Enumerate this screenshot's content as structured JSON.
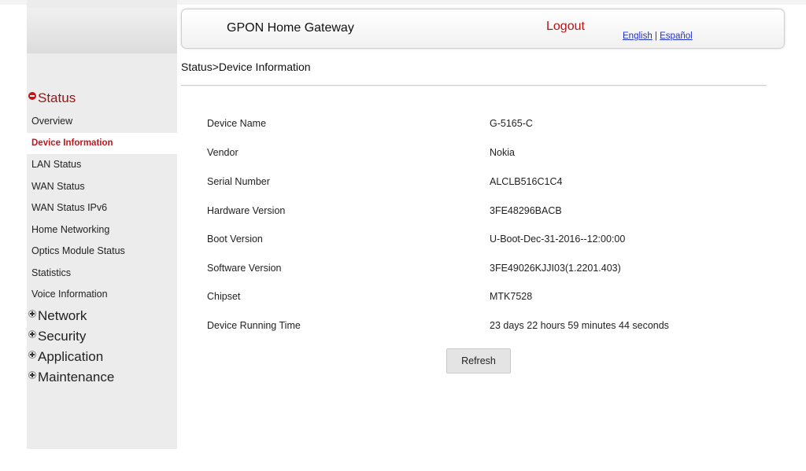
{
  "header": {
    "title": "GPON Home Gateway",
    "logout": "Logout",
    "lang_english": "English",
    "lang_sep": "|",
    "lang_espanol": "Español"
  },
  "breadcrumb": "Status>Device Information",
  "sidebar": {
    "sections": [
      {
        "label": "Status",
        "expanded": true,
        "items": [
          {
            "label": "Overview"
          },
          {
            "label": "Device Information",
            "active": true
          },
          {
            "label": "LAN Status"
          },
          {
            "label": "WAN Status"
          },
          {
            "label": "WAN Status IPv6"
          },
          {
            "label": "Home Networking"
          },
          {
            "label": "Optics Module Status"
          },
          {
            "label": "Statistics"
          },
          {
            "label": "Voice Information"
          }
        ]
      },
      {
        "label": "Network",
        "expanded": false
      },
      {
        "label": "Security",
        "expanded": false
      },
      {
        "label": "Application",
        "expanded": false
      },
      {
        "label": "Maintenance",
        "expanded": false
      }
    ]
  },
  "device_info": [
    {
      "label": "Device Name",
      "value": "G-5165-C"
    },
    {
      "label": "Vendor",
      "value": "Nokia"
    },
    {
      "label": "Serial Number",
      "value": "ALCLB516C1C4"
    },
    {
      "label": "Hardware Version",
      "value": "3FE48296BACB"
    },
    {
      "label": "Boot Version",
      "value": "U-Boot-Dec-31-2016--12:00:00"
    },
    {
      "label": "Software Version",
      "value": "3FE49026KJJI03(1.2201.403)"
    },
    {
      "label": "Chipset",
      "value": "MTK7528"
    },
    {
      "label": "Device Running Time",
      "value": "23 days 22 hours 59 minutes 44 seconds"
    }
  ],
  "refresh_label": "Refresh",
  "colors": {
    "accent_red": "#c0171c",
    "active_menu_text": "#c0171c",
    "link_blue": "#1f2fcc",
    "sidebar_bg": "#ececec"
  },
  "icons": {
    "expanded_section": "minus-circle-icon",
    "collapsed_section": "plus-circle-icon"
  }
}
